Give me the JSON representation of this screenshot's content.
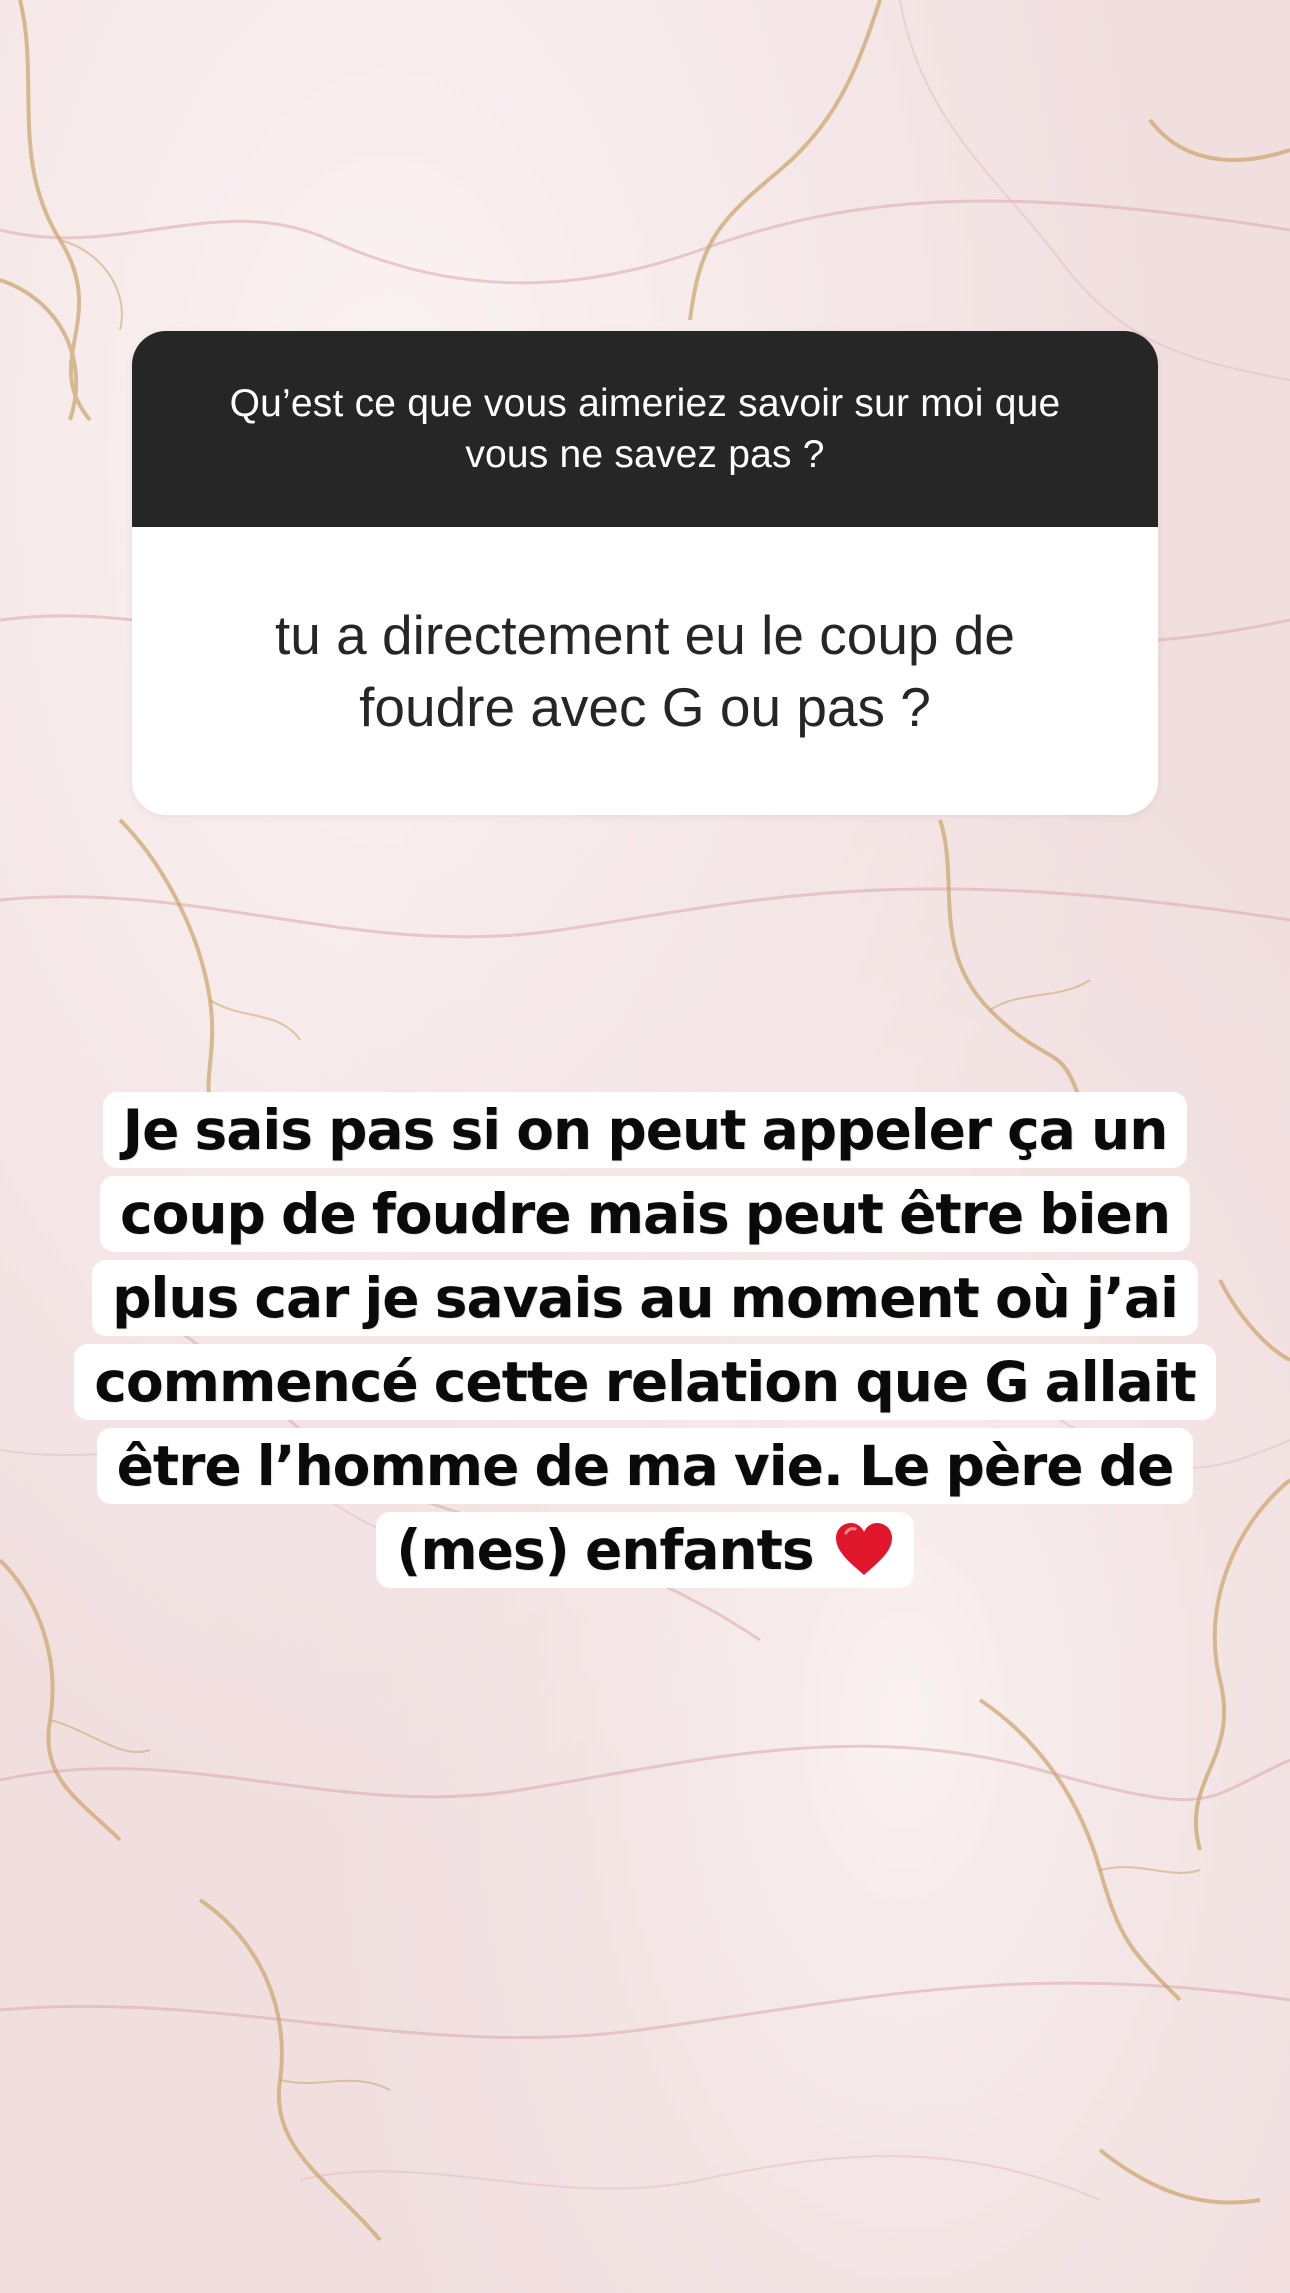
{
  "question": {
    "prompt": "Qu’est ce que vous aimeriez savoir sur moi que vous ne savez pas ?",
    "answer": "tu a directement eu le coup de foudre avec G ou pas ?"
  },
  "response": {
    "text": "Je sais pas si on peut appeler ça un coup de foudre mais peut être bien plus car je savais au moment où j’ai commencé cette relation que G allait être l’homme de ma vie. Le père de (mes) enfants",
    "emoji": "heart-icon"
  },
  "colors": {
    "background": "#f6e9ea",
    "header": "#262626",
    "heart": "#e0162b",
    "vein_gold": "#c9a46a",
    "vein_pink": "#d9a9ad"
  }
}
